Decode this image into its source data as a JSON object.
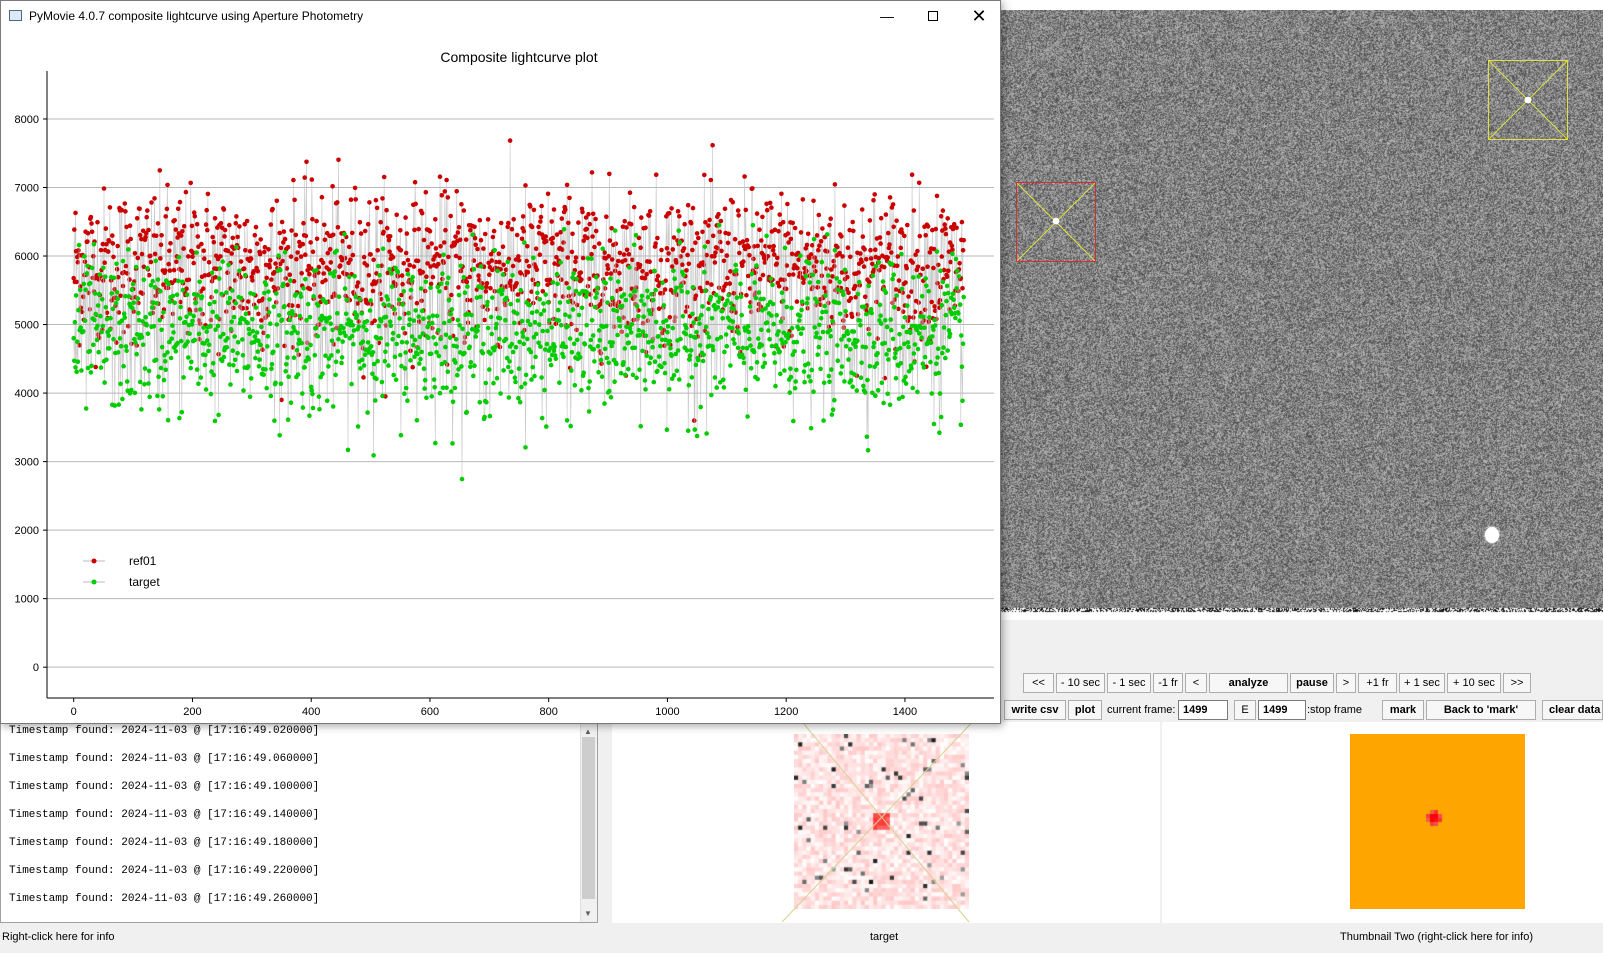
{
  "plot_window": {
    "title": "PyMovie 4.0.7 composite lightcurve using Aperture Photometry",
    "icons": {
      "app": "app-icon",
      "minimize": "minimize-icon",
      "maximize": "maximize-icon",
      "close": "close-icon"
    }
  },
  "chart_data": {
    "type": "scatter",
    "title": "Composite lightcurve plot",
    "xlabel": "",
    "ylabel": "",
    "xlim": [
      -45,
      1550
    ],
    "ylim": [
      -450,
      8700
    ],
    "xticks": [
      "0",
      "200",
      "400",
      "600",
      "800",
      "1000",
      "1200",
      "1400"
    ],
    "yticks": [
      "0",
      "1000",
      "2000",
      "3000",
      "4000",
      "5000",
      "6000",
      "7000",
      "8000"
    ],
    "grid": "horizontal",
    "legend": "left",
    "connected": true,
    "series": [
      {
        "name": "ref01",
        "color": "#cc0000",
        "mean": 5850,
        "sd": 560,
        "min": 3100,
        "max": 8200,
        "n_points": 1500
      },
      {
        "name": "target",
        "color": "#00cc00",
        "mean": 4850,
        "sd": 560,
        "min": 2300,
        "max": 6450,
        "n_points": 1500
      }
    ]
  },
  "controls": {
    "row1": [
      "<<",
      "- 10 sec",
      "- 1 sec",
      "-1 fr",
      "<",
      "analyze",
      "pause",
      ">",
      "+1 fr",
      "+ 1 sec",
      "+ 10 sec",
      ">>"
    ],
    "write_csv": "write csv",
    "plot": "plot",
    "current_frame_label": "current frame:",
    "current_frame_value": "1499",
    "e_button": "E",
    "stop_frame_value": "1499",
    "stop_frame_label": ":stop frame",
    "mark": "mark",
    "back_to_mark": "Back to 'mark'",
    "clear_data": "clear data"
  },
  "log": {
    "lines": [
      "Timestamp found: 2024-11-03 @ [17:16:49.020000]",
      "Timestamp found: 2024-11-03 @ [17:16:49.060000]",
      "Timestamp found: 2024-11-03 @ [17:16:49.100000]",
      "Timestamp found: 2024-11-03 @ [17:16:49.140000]",
      "Timestamp found: 2024-11-03 @ [17:16:49.180000]",
      "Timestamp found: 2024-11-03 @ [17:16:49.220000]",
      "Timestamp found: 2024-11-03 @ [17:16:49.260000]"
    ]
  },
  "status": {
    "left": "Right-click here for info",
    "thumb1": "target",
    "thumb2": "Thumbnail Two (right-click here for info)"
  },
  "colors": {
    "ref_aperture": "#d03030",
    "target_aperture": "#e0e040",
    "thumb2_bg": "#ffa500"
  }
}
